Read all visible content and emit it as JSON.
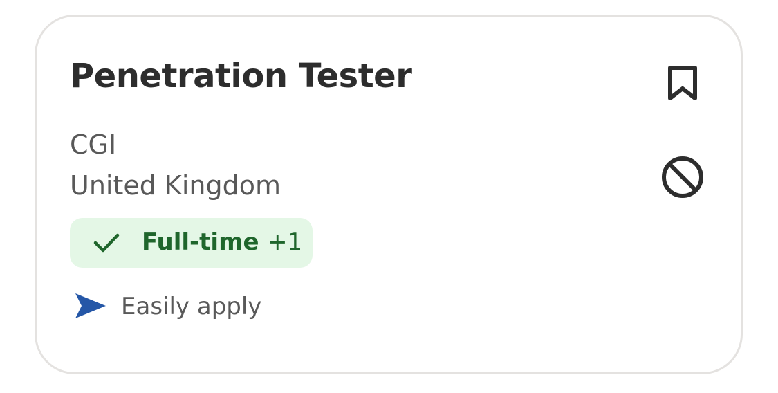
{
  "job": {
    "title": "Penetration Tester",
    "company": "CGI",
    "location": "United Kingdom",
    "tag": {
      "label": "Full-time",
      "extra": "+1",
      "icon": "check-icon"
    },
    "apply": {
      "label": "Easily apply",
      "icon": "send-arrow-icon"
    }
  },
  "actions": {
    "bookmark_icon": "bookmark-icon",
    "not_interested_icon": "block-icon"
  },
  "colors": {
    "title": "#2d2d2d",
    "secondary_text": "#595959",
    "tag_background": "#e4f7e6",
    "tag_text": "#1f662c",
    "apply_icon": "#2557a7",
    "card_border": "#e4e2e0",
    "icon": "#2d2d2d"
  }
}
